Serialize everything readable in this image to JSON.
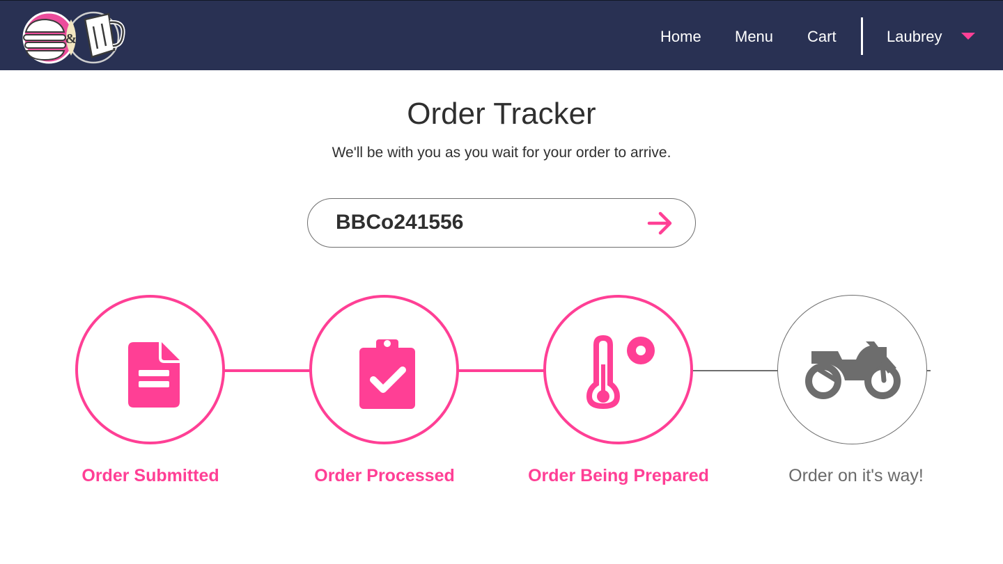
{
  "brand": {
    "logo_icon": "burger-and-beer-logo",
    "colors": {
      "navbar": "#293153",
      "accent": "#ff3f95",
      "pending": "#6d6d6d",
      "text": "#2f2f2f"
    }
  },
  "nav": {
    "links": [
      {
        "label": "Home"
      },
      {
        "label": "Menu"
      },
      {
        "label": "Cart"
      }
    ],
    "user": {
      "name": "Laubrey",
      "menu_icon": "caret-down-icon"
    }
  },
  "page": {
    "title": "Order Tracker",
    "subtitle": "We'll be with you as you wait for your order to arrive."
  },
  "search": {
    "value": "BBCo241556",
    "submit_icon": "arrow-right-icon"
  },
  "steps": [
    {
      "label": "Order Submitted",
      "icon": "document-icon",
      "status": "complete"
    },
    {
      "label": "Order Processed",
      "icon": "clipboard-check-icon",
      "status": "complete"
    },
    {
      "label": "Order Being Prepared",
      "icon": "thermometer-icon",
      "status": "complete"
    },
    {
      "label": "Order on it's way!",
      "icon": "motorcycle-icon",
      "status": "pending"
    }
  ]
}
